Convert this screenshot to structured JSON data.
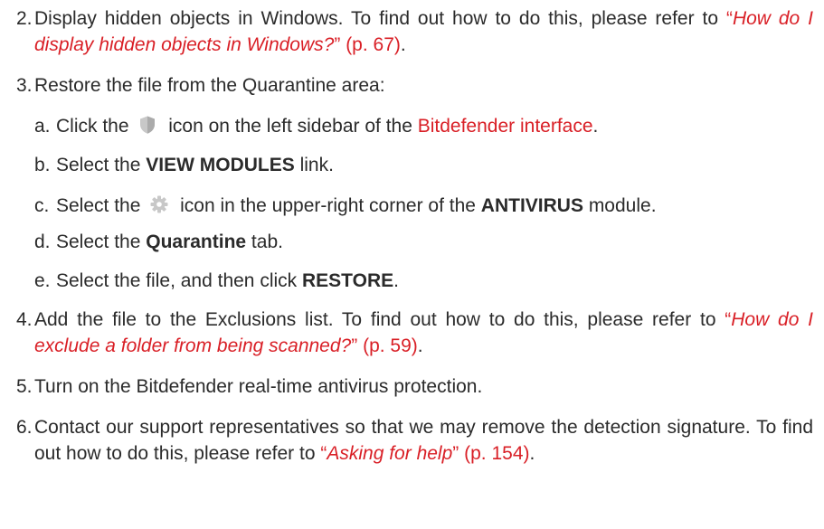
{
  "steps": [
    {
      "num": "2.",
      "text": "Display hidden objects in Windows. To find out how to do this, please refer to ",
      "quote_open": "“",
      "link": "How do I display hidden objects in Windows?",
      "quote_close": "”",
      "page_ref": "(p. 67)",
      "end": "."
    },
    {
      "num": "3.",
      "text": "Restore the file from the Quarantine area:",
      "substeps": [
        {
          "letter": "a.",
          "pre": "Click the",
          "icon": "shield-icon",
          "mid": "icon on the left sidebar of the ",
          "link": "Bitdefender interface",
          "end": "."
        },
        {
          "letter": "b.",
          "pre": "Select the ",
          "bold": "VIEW MODULES",
          "end": " link."
        },
        {
          "letter": "c.",
          "pre": "Select the",
          "icon": "gear-icon",
          "mid": "icon in the upper-right corner of the ",
          "bold": "ANTIVIRUS",
          "end": " module."
        },
        {
          "letter": "d.",
          "pre": "Select the ",
          "bold": "Quarantine",
          "end": " tab."
        },
        {
          "letter": "e.",
          "pre": "Select the file, and then click ",
          "bold": "RESTORE",
          "end": "."
        }
      ]
    },
    {
      "num": "4.",
      "text": "Add the file to the Exclusions list. To find out how to do this, please refer to ",
      "quote_open": "“",
      "link": "How do I exclude a folder from being scanned?",
      "quote_close": "”",
      "page_ref": "(p. 59)",
      "end": "."
    },
    {
      "num": "5.",
      "text": "Turn on the Bitdefender real-time antivirus protection."
    },
    {
      "num": "6.",
      "text": "Contact our support representatives so that we may remove the detection signature. To find out how to do this, please refer to ",
      "quote_open": "“",
      "link": "Asking for help",
      "quote_close": "”",
      "page_ref": "(p. 154)",
      "end": "."
    }
  ],
  "colors": {
    "text": "#2b2b2b",
    "link": "#d91f26",
    "icon": "#c8c8c8"
  }
}
